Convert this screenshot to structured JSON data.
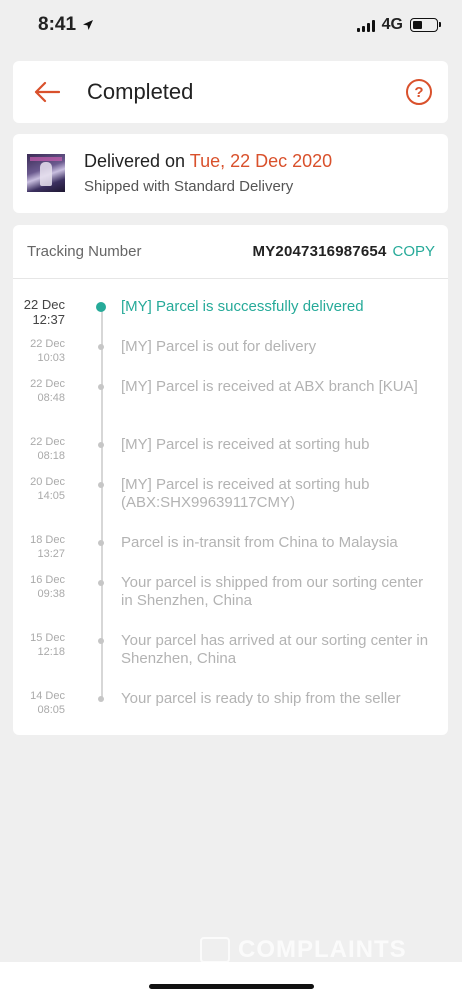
{
  "status_bar": {
    "time": "8:41",
    "network": "4G"
  },
  "header": {
    "title": "Completed",
    "help_glyph": "?"
  },
  "delivery": {
    "delivered_prefix": "Delivered on",
    "delivered_date": "Tue, 22 Dec 2020",
    "shipping_method": "Shipped with Standard Delivery"
  },
  "tracking": {
    "label": "Tracking Number",
    "number": "MY2047316987654",
    "copy_label": "COPY"
  },
  "events": [
    {
      "date": "22 Dec",
      "time": "12:37",
      "text": "[MY] Parcel is successfully delivered",
      "active": true
    },
    {
      "date": "22 Dec",
      "time": "10:03",
      "text": "[MY] Parcel is out for delivery"
    },
    {
      "date": "22 Dec",
      "time": "08:48",
      "text": "[MY] Parcel is received at ABX branch [KUA]"
    },
    {
      "date": "22 Dec",
      "time": "08:18",
      "text": "[MY] Parcel is received at sorting hub"
    },
    {
      "date": "20 Dec",
      "time": "14:05",
      "text": "[MY] Parcel is received at sorting hub (ABX:SHX99639117CMY)"
    },
    {
      "date": "18 Dec",
      "time": "13:27",
      "text": "Parcel is in-transit from China to Malaysia"
    },
    {
      "date": "16 Dec",
      "time": "09:38",
      "text": "Your parcel is shipped from our sorting center in Shenzhen, China"
    },
    {
      "date": "15 Dec",
      "time": "12:18",
      "text": "Your parcel has arrived at our sorting center in Shenzhen, China"
    },
    {
      "date": "14 Dec",
      "time": "08:05",
      "text": "Your parcel is ready to ship from the seller"
    }
  ],
  "watermark": {
    "text": "COMPLAINTS"
  },
  "colors": {
    "accent": "#d9512c",
    "success": "#26aa99",
    "muted": "#b3b3b3"
  }
}
